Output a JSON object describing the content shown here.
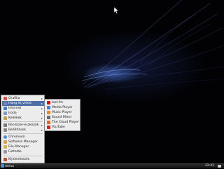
{
  "menu": {
    "items": [
      {
        "label": "Grafika",
        "icon": "graphics-icon",
        "color": "#e0503a",
        "submenu": true
      },
      {
        "label": "Hang és videó",
        "icon": "multimedia-icon",
        "color": "#6a86c8",
        "submenu": true,
        "selected": true
      },
      {
        "label": "Internet",
        "icon": "internet-icon",
        "color": "#3d7fd6",
        "submenu": true
      },
      {
        "label": "Iroda",
        "icon": "office-icon",
        "color": "#7a9ccc",
        "submenu": true
      },
      {
        "label": "Kellékek",
        "icon": "accessories-icon",
        "color": "#c79a4a",
        "submenu": true
      },
      {
        "label": "Rendszer-eszközök",
        "icon": "system-tools-icon",
        "color": "#7a7a7a",
        "submenu": true
      },
      {
        "label": "Beállítások",
        "icon": "settings-icon",
        "color": "#8a8a8a",
        "submenu": true
      },
      {
        "label": "Chromium",
        "icon": "chromium-icon",
        "color": "#4a90e2"
      },
      {
        "label": "Software Manager",
        "icon": "software-manager-icon",
        "color": "#e0a040"
      },
      {
        "label": "File Manager",
        "icon": "file-manager-icon",
        "color": "#d8b24a"
      },
      {
        "label": "Futtatás",
        "icon": "run-icon",
        "color": "#9a9a9a"
      },
      {
        "label": "Kijelentkezés",
        "icon": "logout-icon",
        "color": "#c84a3a"
      }
    ],
    "submenu_items": [
      {
        "label": "last.fm",
        "icon": "lastfm-icon",
        "color": "#d51007"
      },
      {
        "label": "Media Player",
        "icon": "media-player-icon",
        "color": "#4a7ad0"
      },
      {
        "label": "Music Player",
        "icon": "music-player-icon",
        "color": "#e08a2a"
      },
      {
        "label": "Sound Mixer",
        "icon": "sound-mixer-icon",
        "color": "#6a6a6a"
      },
      {
        "label": "The Cloud Player",
        "icon": "cloud-player-icon",
        "color": "#e06a20"
      },
      {
        "label": "YouTube",
        "icon": "youtube-icon",
        "color": "#d82020"
      }
    ]
  },
  "taskbar": {
    "start_label": "menu",
    "clock": "22:43"
  }
}
